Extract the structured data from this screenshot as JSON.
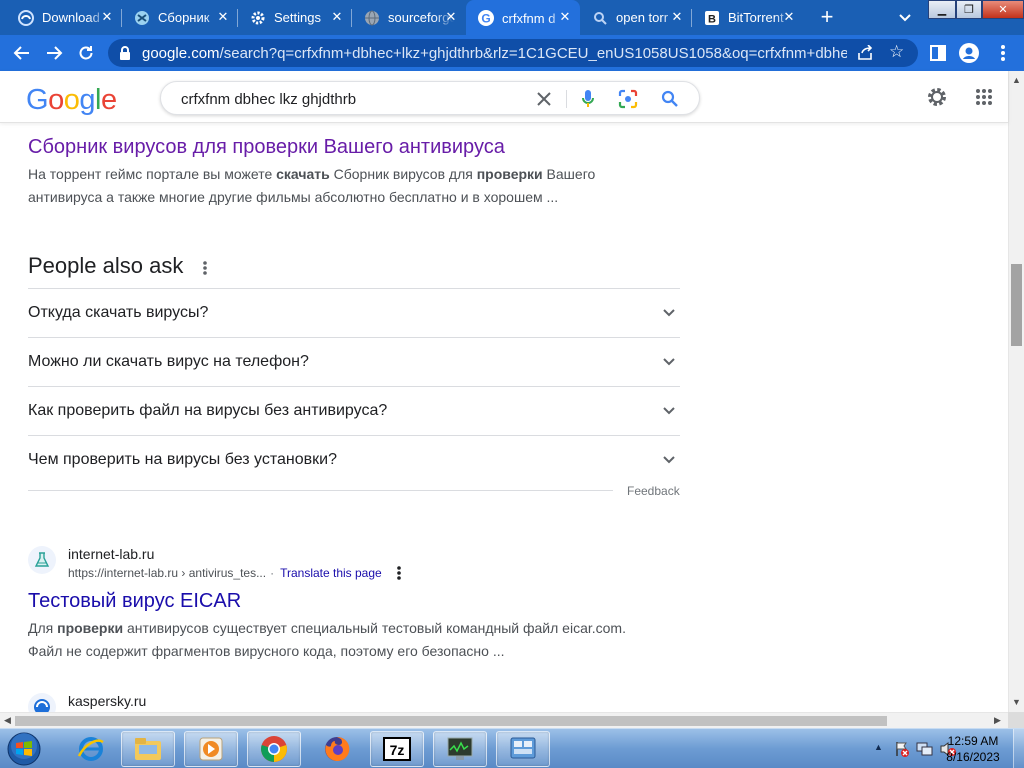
{
  "browser": {
    "tabs": [
      {
        "label": "Download",
        "icon": "edge-icon",
        "active": false
      },
      {
        "label": "Сборник",
        "icon": "site-icon",
        "active": false
      },
      {
        "label": "Settings",
        "icon": "gear-icon",
        "active": false
      },
      {
        "label": "sourceforge",
        "icon": "globe-icon",
        "active": false
      },
      {
        "label": "crfxfnm d",
        "icon": "google-icon",
        "active": true
      },
      {
        "label": "open torr",
        "icon": "search-icon",
        "active": false
      },
      {
        "label": "BitTorrent",
        "icon": "bittorrent-icon",
        "active": false
      }
    ],
    "new_tab_label": "+",
    "address": {
      "host": "google.com",
      "path": "/search?q=crfxfnm+dbhec+lkz+ghjdthrb&rlz=1C1GCEU_enUS1058US1058&oq=crfxfnm+dbhec+lkz..."
    },
    "colors": {
      "tabstrip": "#1a5fb4",
      "toolbar": "#2370dc",
      "omnibox": "#0f4ea8"
    }
  },
  "google": {
    "logo_letters": [
      {
        "ch": "G",
        "color": "#4285f4"
      },
      {
        "ch": "o",
        "color": "#ea4335"
      },
      {
        "ch": "o",
        "color": "#fbbc05"
      },
      {
        "ch": "g",
        "color": "#4285f4"
      },
      {
        "ch": "l",
        "color": "#34a853"
      },
      {
        "ch": "e",
        "color": "#ea4335"
      }
    ],
    "search_value": "crfxfnm dbhec lkz ghjdthrb"
  },
  "results": {
    "first": {
      "title": "Сборник вирусов для проверки Вашего антивируса",
      "snippet_html": "На торрент геймс портале вы можете <b>скачать</b> Сборник вирусов для <b>проверки</b> Вашего антивируса а также многие другие фильмы абсолютно бесплатно и в хорошем ..."
    },
    "paa": {
      "title": "People also ask",
      "questions": [
        "Откуда скачать вирусы?",
        "Можно ли скачать вирус на телефон?",
        "Как проверить файл на вирусы без антивируса?",
        "Чем проверить на вирусы без установки?"
      ],
      "feedback": "Feedback"
    },
    "second": {
      "site": "internet-lab.ru",
      "url": "https://internet-lab.ru › antivirus_tes...",
      "translate": "Translate this page",
      "title": "Тестовый вирус EICAR",
      "snippet_html": "Для <b>проверки</b> антивирусов существует специальный тестовый командный файл eicar.com. Файл не содержит фрагментов вирусного кода, поэтому его безопасно ..."
    },
    "third": {
      "site": "kaspersky.ru"
    }
  },
  "taskbar": {
    "apps": [
      "ie-icon",
      "explorer-icon",
      "media-player-icon",
      "chrome-icon",
      "firefox-icon",
      "7zip-icon",
      "task-manager-icon",
      "network-icon"
    ],
    "time": "12:59 AM",
    "date": "8/16/2023"
  }
}
